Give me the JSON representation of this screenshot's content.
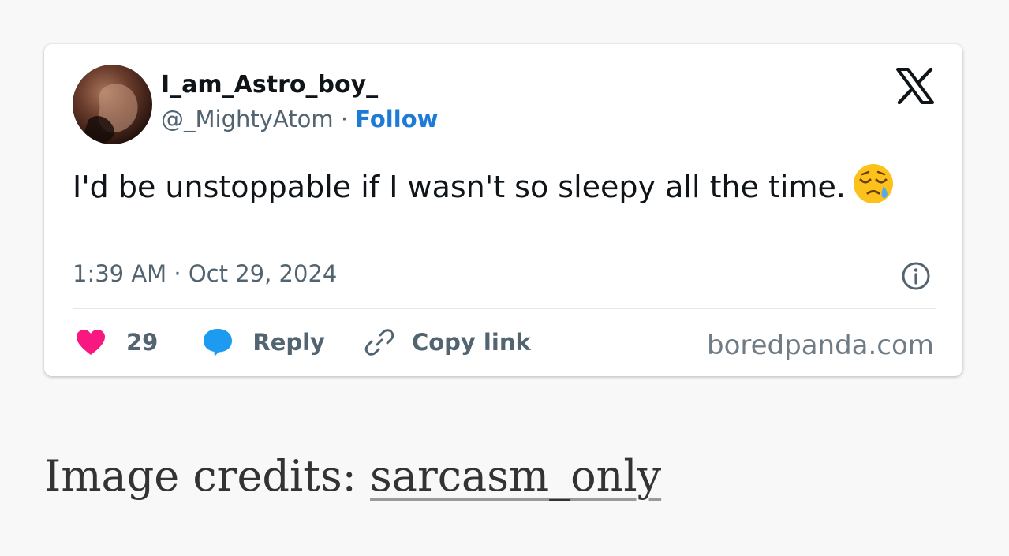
{
  "tweet": {
    "display_name": "I_am_Astro_boy_",
    "handle": "@_MightyAtom",
    "separator": "·",
    "follow_label": "Follow",
    "text_main": "I'd be unstoppable if I wasn't so sleepy all the time.",
    "emoji_name": "sleepy-face-emoji",
    "timestamp": "1:39 AM · Oct 29, 2024",
    "actions": {
      "like_count": "29",
      "reply_label": "Reply",
      "copy_link_label": "Copy link"
    },
    "site": "boredpanda.com",
    "colors": {
      "follow": "#1d7ad6",
      "like_heart": "#f91880",
      "reply_bubble": "#1d9bf0",
      "muted_text": "#536471"
    }
  },
  "credits": {
    "prefix": "Image credits: ",
    "link_text": "sarcasm_only"
  }
}
